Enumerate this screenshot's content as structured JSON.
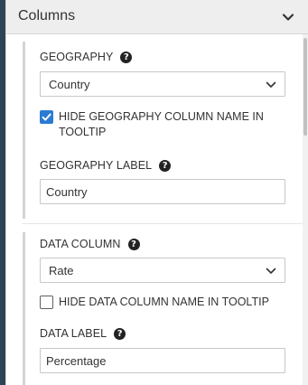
{
  "panel": {
    "title": "Columns"
  },
  "geography": {
    "label": "GEOGRAPHY",
    "select_value": "Country",
    "hide_name_label": "HIDE GEOGRAPHY COLUMN NAME IN TOOLTIP",
    "hide_name_checked": true,
    "display_label": "GEOGRAPHY LABEL",
    "display_value": "Country"
  },
  "data_column": {
    "label": "DATA COLUMN",
    "select_value": "Rate",
    "hide_name_label": "HIDE DATA COLUMN NAME IN TOOLTIP",
    "hide_name_checked": false,
    "display_label": "DATA LABEL",
    "display_value": "Percentage"
  },
  "colors": {
    "accent": "#2b7bd1",
    "header_bg": "#eeeeee",
    "left_strip": "#2f4356"
  },
  "icons": {
    "help": "?",
    "chevron": "chevron-down-icon",
    "check": "check-icon"
  }
}
